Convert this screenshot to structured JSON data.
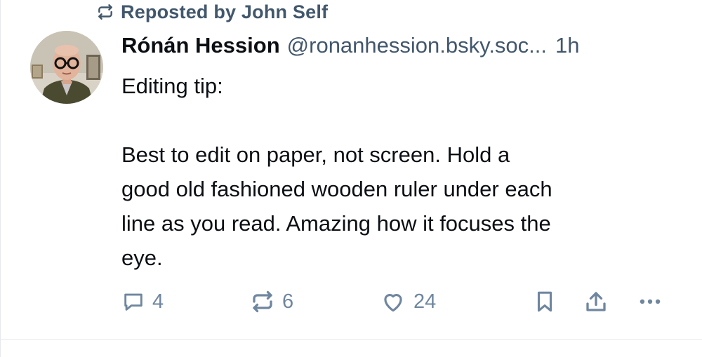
{
  "repost": {
    "icon": "repost-icon",
    "text": "Reposted by John Self"
  },
  "author": {
    "avatar_icon": "avatar",
    "name": "Rónán Hession",
    "handle": "@ronanhession.bsky.soc...",
    "timestamp": "1h"
  },
  "post": {
    "text": "Editing tip:\n\nBest to edit on paper, not screen. Hold a\ngood old fashioned wooden ruler under each\nline as you read. Amazing how it focuses the\neye."
  },
  "actions": {
    "reply": {
      "icon": "reply-icon",
      "count": "4"
    },
    "repost": {
      "icon": "repost-icon",
      "count": "6"
    },
    "like": {
      "icon": "heart-icon",
      "count": "24"
    },
    "bookmark": {
      "icon": "bookmark-icon"
    },
    "share": {
      "icon": "share-icon"
    },
    "more": {
      "icon": "more-icon"
    }
  },
  "colors": {
    "secondary_text": "#42576c",
    "action_icon": "#6f869f",
    "text": "#0b0f14"
  }
}
